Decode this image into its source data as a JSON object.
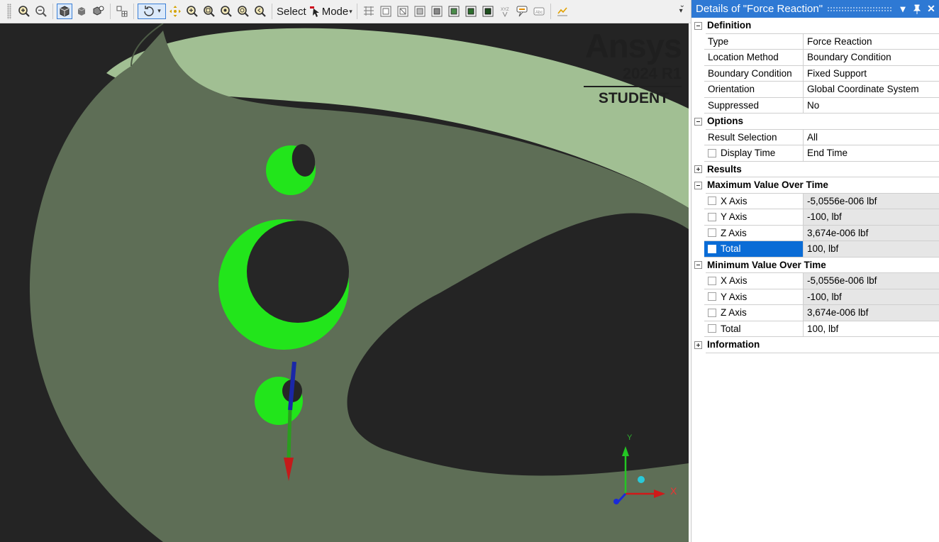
{
  "toolbar": {
    "select_label": "Select",
    "mode_label": "Mode"
  },
  "viewport": {
    "logo": {
      "brand": "Ansys",
      "version": "2024 R1",
      "edition": "STUDENT"
    },
    "triad": {
      "x_label": "X",
      "y_label": "Y"
    },
    "colors": {
      "body": "#5e6e56",
      "body_top": "#a1bf93",
      "background": "#242424",
      "hole_face": "#22e51b"
    }
  },
  "details": {
    "title": "Details of \"Force Reaction\"",
    "sections": {
      "definition": {
        "title": "Definition",
        "rows": [
          {
            "label": "Type",
            "value": "Force Reaction"
          },
          {
            "label": "Location Method",
            "value": "Boundary Condition"
          },
          {
            "label": "Boundary Condition",
            "value": "Fixed Support"
          },
          {
            "label": "Orientation",
            "value": "Global Coordinate System"
          },
          {
            "label": "Suppressed",
            "value": "No"
          }
        ]
      },
      "options": {
        "title": "Options",
        "rows": [
          {
            "label": "Result Selection",
            "value": "All"
          },
          {
            "label": "Display Time",
            "value": "End Time"
          }
        ]
      },
      "results": {
        "title": "Results"
      },
      "maximum": {
        "title": "Maximum Value Over Time",
        "rows": [
          {
            "label": "X Axis",
            "value": "-5,0556e-006 lbf"
          },
          {
            "label": "Y Axis",
            "value": "-100, lbf"
          },
          {
            "label": "Z Axis",
            "value": "3,674e-006 lbf"
          },
          {
            "label": "Total",
            "value": "100, lbf"
          }
        ]
      },
      "minimum": {
        "title": "Minimum Value Over Time",
        "rows": [
          {
            "label": "X Axis",
            "value": "-5,0556e-006 lbf"
          },
          {
            "label": "Y Axis",
            "value": "-100, lbf"
          },
          {
            "label": "Z Axis",
            "value": "3,674e-006 lbf"
          },
          {
            "label": "Total",
            "value": "100, lbf"
          }
        ]
      },
      "information": {
        "title": "Information"
      }
    }
  }
}
